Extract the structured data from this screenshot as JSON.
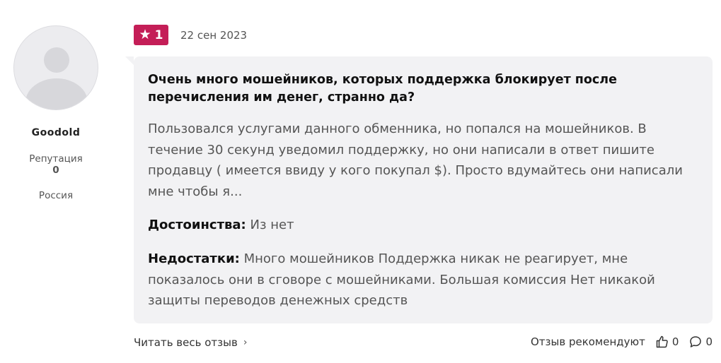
{
  "author": {
    "name": "Goodold",
    "reputation_label": "Репутация",
    "reputation_value": "0",
    "country": "Россия"
  },
  "review": {
    "rating": "1",
    "date": "22 сен 2023",
    "title": "Очень много мошейников, которых поддержка блокирует после перечисления им денег, странно да?",
    "text": "Пользовался услугами данного обменника, но попался на мошейников. В течение 30 секунд уведомил поддержку, но они написали в ответ пишите продавцу ( имеется ввиду у кого покупал $). Просто вдумайтесь они написали мне чтобы я...",
    "pros_label": "Достоинства:",
    "pros_text": "Из нет",
    "cons_label": "Недостатки:",
    "cons_text": "Много мошейников Поддержка никак не реагирует, мне показалось они в сговоре с мошейниками. Большая комиссия Нет никакой защиты переводов денежных средств"
  },
  "footer": {
    "read_more": "Читать весь отзыв",
    "recommend_label": "Отзыв рекомендуют",
    "likes": "0",
    "comments": "0"
  },
  "colors": {
    "badge": "#c41e57",
    "card_bg": "#f2f2f4"
  }
}
